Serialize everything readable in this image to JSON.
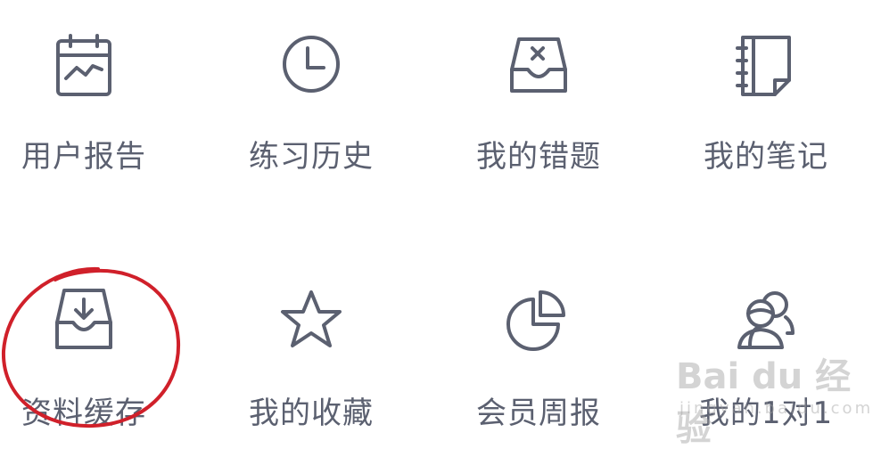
{
  "colors": {
    "icon_stroke": "#5b6070",
    "label_text": "#5b6070",
    "annotation": "#d0202a",
    "watermark": "#a0a0a0"
  },
  "menu": {
    "row1": [
      {
        "label": "用户报告",
        "icon": "report-calendar-icon"
      },
      {
        "label": "练习历史",
        "icon": "clock-icon"
      },
      {
        "label": "我的错题",
        "icon": "wrong-questions-tray-icon"
      },
      {
        "label": "我的笔记",
        "icon": "notebook-icon"
      }
    ],
    "row2": [
      {
        "label": "资料缓存",
        "icon": "download-tray-icon"
      },
      {
        "label": "我的收藏",
        "icon": "star-icon"
      },
      {
        "label": "会员周报",
        "icon": "pie-chart-icon"
      },
      {
        "label": "我的1对1",
        "icon": "chat-people-icon"
      }
    ]
  },
  "watermark": {
    "brand": "Bai du 经验",
    "sub": "jingyan.baidu.com"
  }
}
